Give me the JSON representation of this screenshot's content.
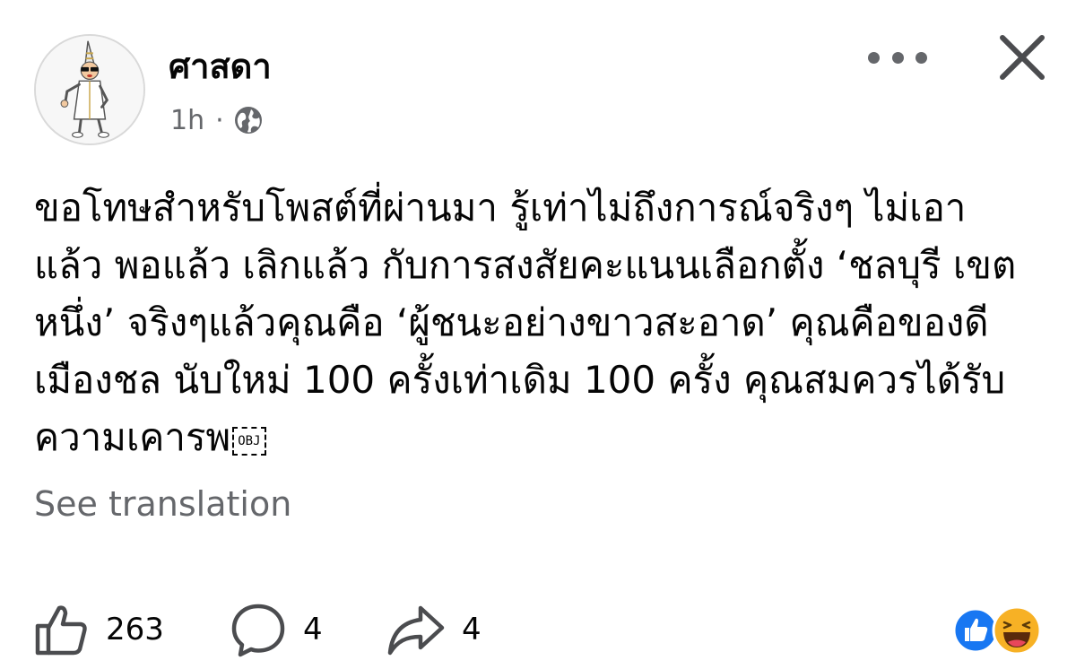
{
  "post": {
    "author": "ศาสดา",
    "time": "1h",
    "separator": "·",
    "privacy_icon": "globe-icon",
    "text_lines": [
      "ขอโทษสำหรับโพสต์ที่ผ่านมา รู้เท่าไม่ถึงการณ์จริงๆ ไม่เอา",
      "แล้ว พอแล้ว เลิกแล้ว กับการสงสัยคะแนนเลือกตั้ง ‘ชลบุรี เขต",
      "หนึ่ง’ จริงๆแล้วคุณคือ ‘ผู้ชนะอย่างขาวสะอาด’ คุณคือของดี",
      "เมืองชล นับใหม่ 100 ครั้งเท่าเดิม 100 ครั้ง คุณสมควรได้รับ",
      "ความเคารพ"
    ],
    "obj_placeholder": "OBJ",
    "see_translation": "See translation"
  },
  "actions": {
    "like": {
      "icon": "thumbs-up-icon",
      "count": "263"
    },
    "comment": {
      "icon": "comment-bubble-icon",
      "count": "4"
    },
    "share": {
      "icon": "share-arrow-icon",
      "count": "4"
    }
  },
  "reactions": [
    "like-reaction-icon",
    "haha-reaction-icon"
  ],
  "colors": {
    "text": "#050505",
    "secondary": "#65676b",
    "like_blue": "#1877f2",
    "haha_yellow": "#f7b125"
  }
}
